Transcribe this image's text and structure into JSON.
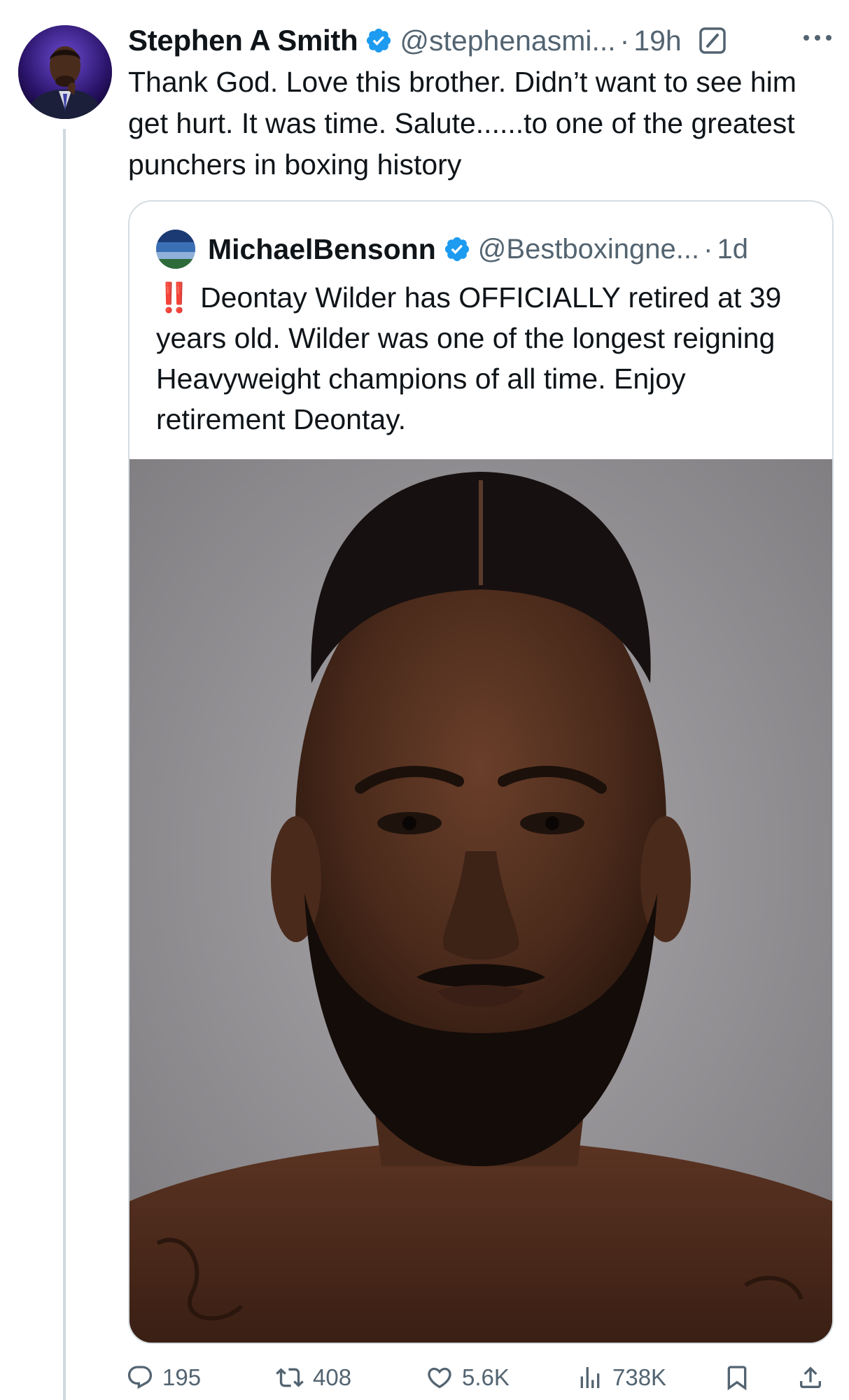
{
  "tweet": {
    "author_name": "Stephen A Smith",
    "handle": "@stephenasmi...",
    "separator": "·",
    "time": "19h",
    "text": "Thank God. Love this brother. Didn’t want to see him get hurt. It was time.  Salute......to one of the greatest punchers in boxing history",
    "icons": {
      "verified": "verified-badge-icon",
      "edit": "edit-icon",
      "more": "more-dots-icon"
    }
  },
  "quote": {
    "author_name": "MichaelBensonn",
    "handle": "@Bestboxingne...",
    "separator": "·",
    "time": "1d",
    "emoji": "‼️",
    "text": "Deontay Wilder has OFFICIALLY retired at 39 years old. Wilder was one of the longest reigning Heavyweight champions of all time. Enjoy retirement Deontay.",
    "image": "photo-of-boxer-portrait"
  },
  "actions": {
    "replies": "195",
    "reposts": "408",
    "likes": "5.6K",
    "views": "738K"
  },
  "colors": {
    "text": "#0f1419",
    "secondary": "#536471",
    "verified": "#1d9bf0",
    "border": "#d6dde1",
    "thread_line": "#cfd9de",
    "alert": "#e0245e"
  }
}
